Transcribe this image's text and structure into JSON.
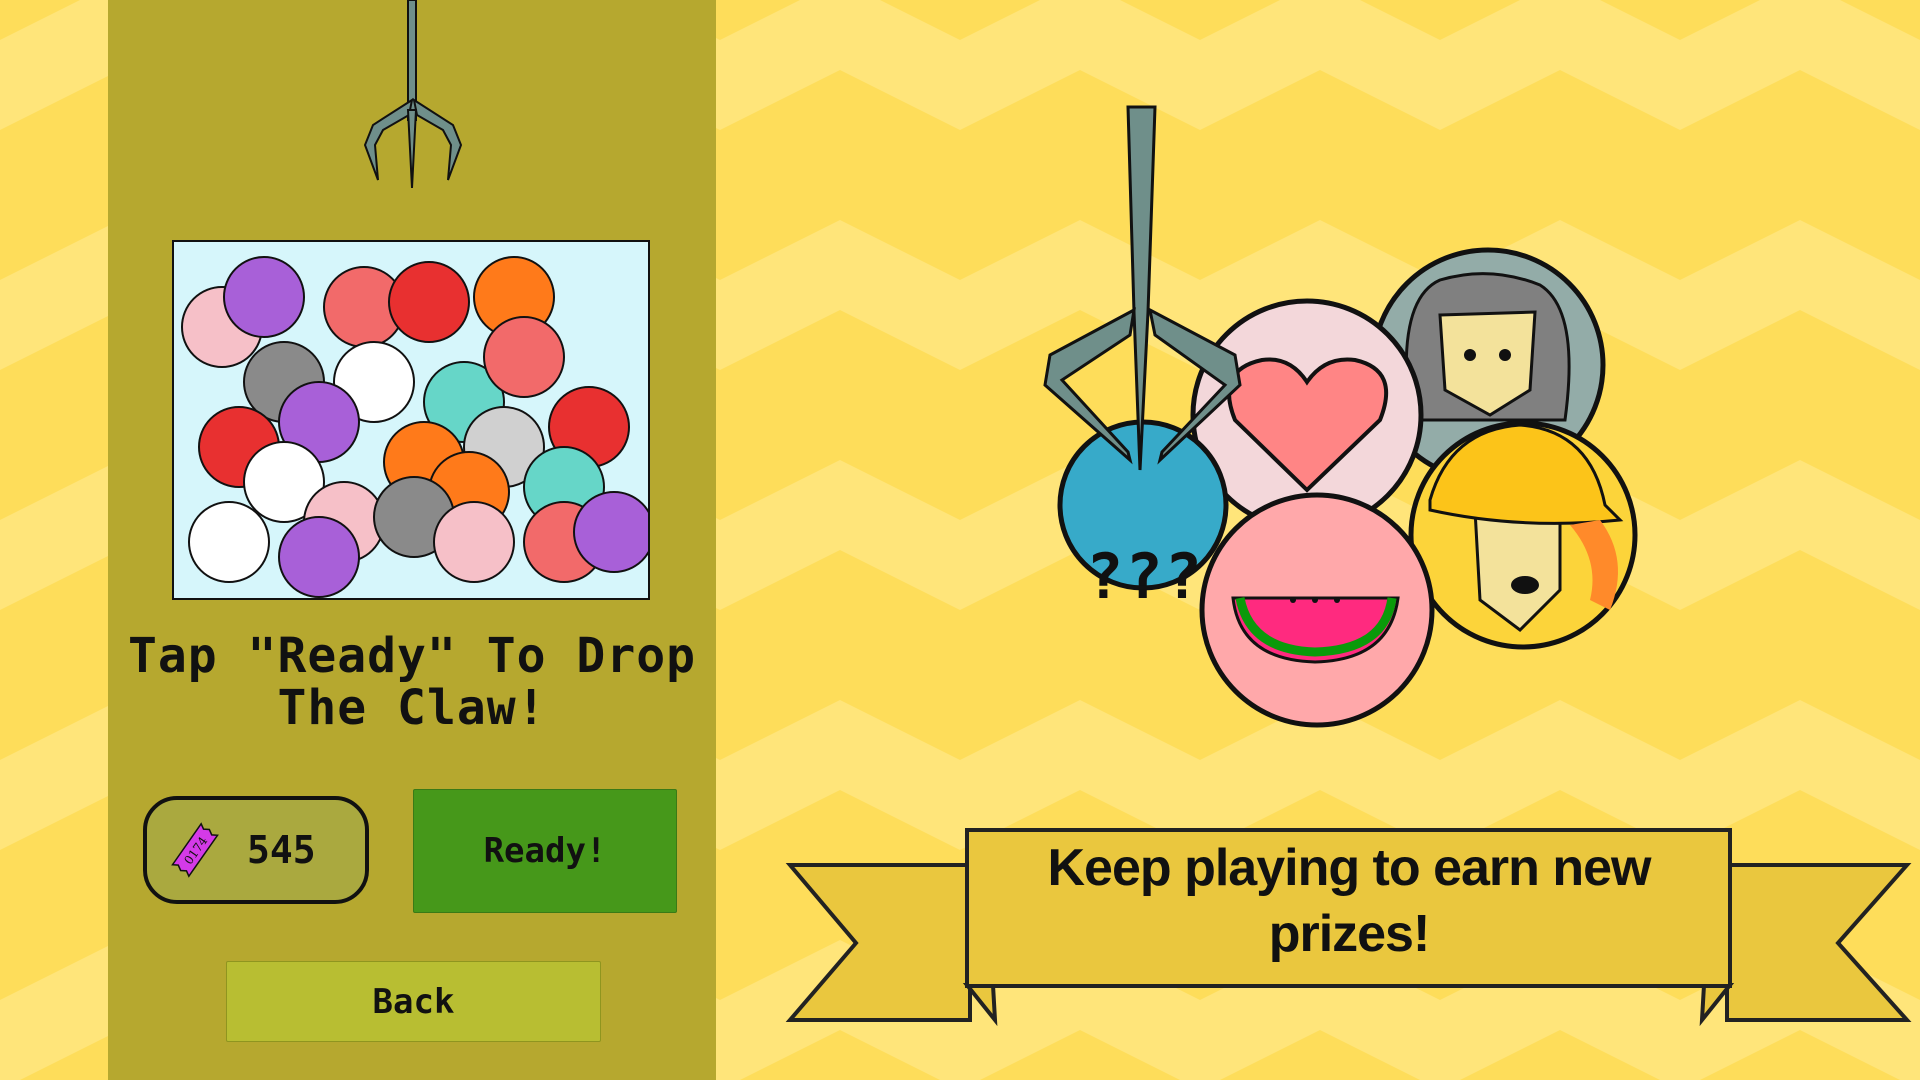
{
  "colors": {
    "bg_dark": "#fedd5a",
    "bg_light": "#ffe57a",
    "panel": "#b6a82f",
    "ready": "#46981a",
    "back": "#b8be32",
    "banner": "#eac73e"
  },
  "left_panel": {
    "instruction": "Tap \"Ready\" To Drop The Claw!",
    "ticket_count": "545",
    "ticket_icon_label": "0174",
    "ready_label": "Ready!",
    "back_label": "Back"
  },
  "prize_display": {
    "mystery_label": "???",
    "banner_text": "Keep playing to earn new prizes!"
  }
}
